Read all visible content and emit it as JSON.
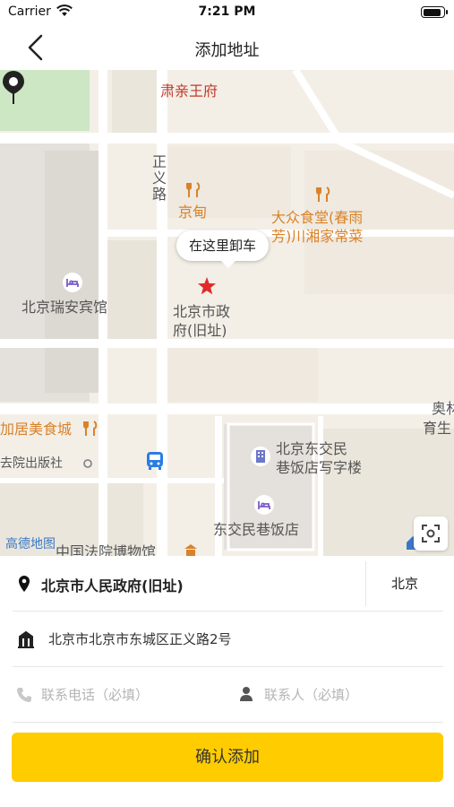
{
  "status_bar": {
    "carrier": "Carrier",
    "time": "7:21 PM",
    "battery_level": 0.9
  },
  "nav": {
    "title": "添加地址"
  },
  "map": {
    "bubble_text": "在这里卸车",
    "labels": {
      "su_prince": "肃亲王府",
      "zhengyi_road": "正义路",
      "jingdian": "京甸",
      "dazhong_1": "大众食堂(春雨",
      "dazhong_2": "芳)川湘家常菜",
      "ruian_hotel": "北京瑞安宾馆",
      "gov_1": "北京市政",
      "gov_2": "府(旧址)",
      "aoyu_1": "奥林",
      "aoyu_2": "育生",
      "meishicheng": "加居美食城",
      "press": "去院出版社",
      "dongjiao_office_1": "北京东交民",
      "dongjiao_office_2": "巷饭店写字楼",
      "dongjiao_hotel": "东交民巷饭店",
      "court_museum": "中国法院博物馆",
      "gaode_logo": "高德地图"
    }
  },
  "form": {
    "place_name": "北京市人民政府(旧址)",
    "city": "北京",
    "address": "北京市北京市东城区正义路2号",
    "phone_placeholder": "联系电话（必填）",
    "contact_placeholder": "联系人（必填）",
    "confirm_label": "确认添加"
  },
  "colors": {
    "accent": "#ffcc00",
    "map_background": "#f3efe7",
    "park_green": "#cde6c3",
    "poi_orange": "#d9822b"
  },
  "icons": {
    "back": "chevron-left-icon",
    "pin": "map-pin-icon",
    "location": "location-pin-icon",
    "building": "building-icon",
    "phone": "phone-icon",
    "person": "person-icon",
    "locate": "locate-icon"
  }
}
